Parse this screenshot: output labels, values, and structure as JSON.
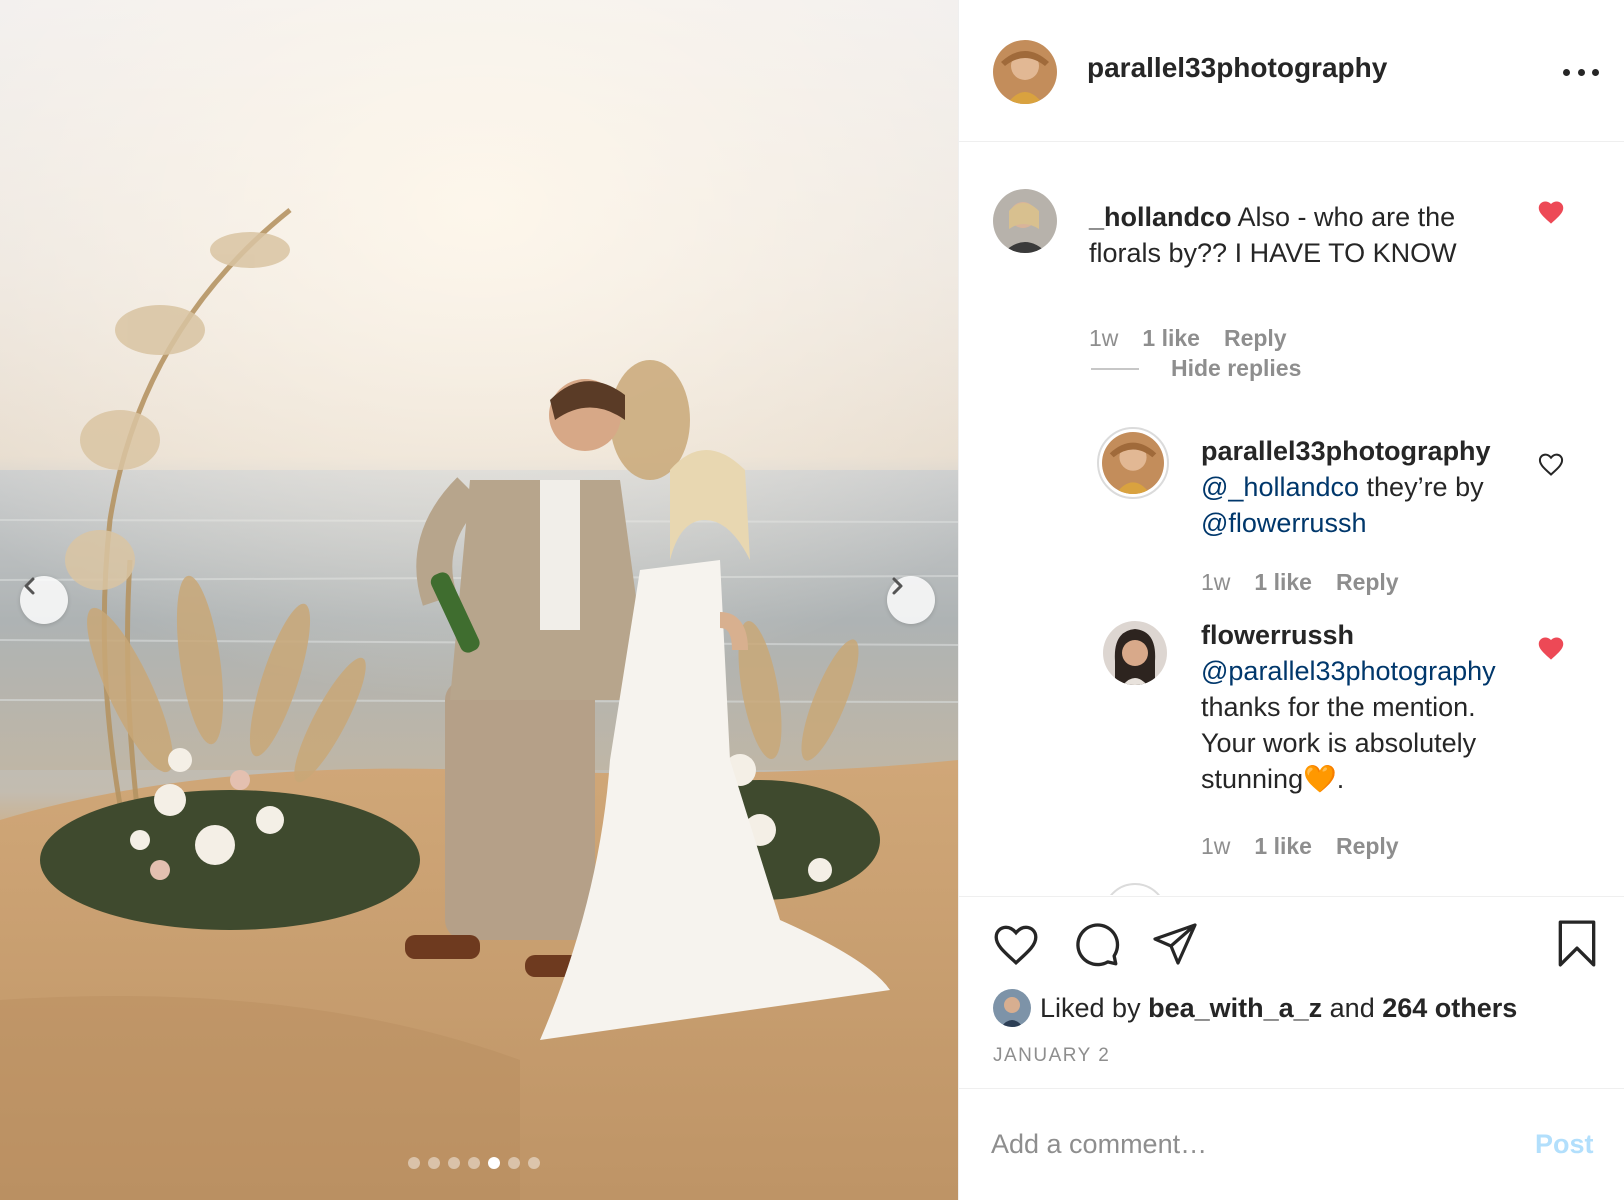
{
  "post": {
    "username": "parallel33photography",
    "image_alt": "Bride and groom popping champagne on a cliff by the ocean with pampas-grass floral arch",
    "carousel": {
      "total": 7,
      "active_index": 4
    }
  },
  "comments": [
    {
      "username": "_hollandco",
      "text": "Also - who are the florals by?? I HAVE TO KNOW",
      "time": "1w",
      "likes": "1 like",
      "reply": "Reply",
      "liked": true
    }
  ],
  "hide_replies_label": "Hide replies",
  "replies": [
    {
      "username": "parallel33photography",
      "mention1": "@_hollandco",
      "text1": " they’re by ",
      "mention2": "@flowerrussh",
      "time": "1w",
      "likes": "1 like",
      "reply": "Reply",
      "liked": false
    },
    {
      "username": "flowerrussh",
      "mention1": "@parallel33photography",
      "text1": "thanks for the mention.",
      "text2": "Your work is absolutely",
      "text3": "stunning🧡.",
      "time": "1w",
      "likes": "1 like",
      "reply": "Reply",
      "liked": true
    }
  ],
  "likes": {
    "prefix": "Liked by ",
    "user": "bea_with_a_z",
    "middle": " and ",
    "others": "264 others"
  },
  "date": "JANUARY 2",
  "comment_box": {
    "placeholder": "Add a comment…",
    "post_label": "Post"
  },
  "colors": {
    "heart_red": "#ed4956",
    "mention_blue": "#00376b",
    "post_disabled": "#b2dffc",
    "muted": "#8e8e8e"
  }
}
